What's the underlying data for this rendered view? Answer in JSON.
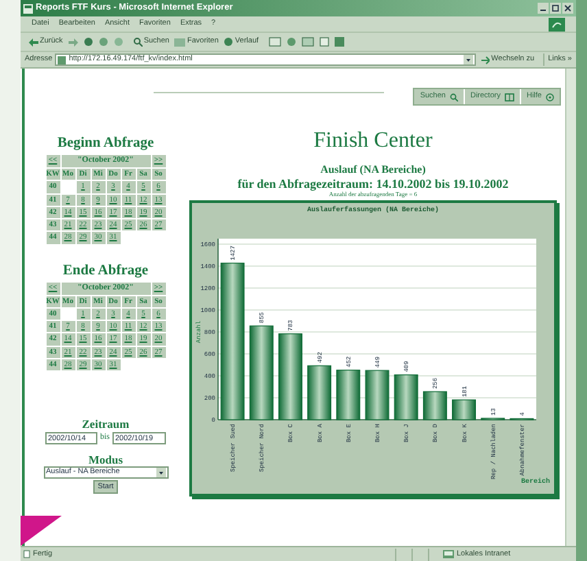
{
  "window": {
    "title": "Reports FTF Kurs - Microsoft Internet Explorer"
  },
  "menu": [
    "Datei",
    "Bearbeiten",
    "Ansicht",
    "Favoriten",
    "Extras",
    "?"
  ],
  "toolbar": {
    "back": "Zurück",
    "search": "Suchen",
    "favorites": "Favoriten",
    "history": "Verlauf"
  },
  "address_bar": {
    "label": "Adresse",
    "value": "http://172.16.49.174/ftf_kv/index.html",
    "go": "Wechseln zu",
    "links": "Links »"
  },
  "nav_buttons": [
    {
      "label": "Suchen",
      "kind": "search"
    },
    {
      "label": "Directory",
      "kind": "directory"
    },
    {
      "label": "Hilfe",
      "kind": "help"
    }
  ],
  "calendars": [
    {
      "heading": "Beginn Abfrage",
      "prev": "<<",
      "month": "\"October 2002\"",
      "next": ">>",
      "columns": [
        "KW",
        "Mo",
        "Di",
        "Mi",
        "Do",
        "Fr",
        "Sa",
        "So"
      ],
      "weeks": [
        {
          "week": "40",
          "leading_blank": true,
          "days": [
            "1",
            "2",
            "3",
            "4",
            "5",
            "6"
          ]
        },
        {
          "week": "41",
          "leading_blank": false,
          "days": [
            "7",
            "8",
            "9",
            "10",
            "11",
            "12",
            "13"
          ]
        },
        {
          "week": "42",
          "leading_blank": false,
          "days": [
            "14",
            "15",
            "16",
            "17",
            "18",
            "19",
            "20"
          ]
        },
        {
          "week": "43",
          "leading_blank": false,
          "days": [
            "21",
            "22",
            "23",
            "24",
            "25",
            "26",
            "27"
          ]
        },
        {
          "week": "44",
          "leading_blank": false,
          "days": [
            "28",
            "29",
            "30",
            "31"
          ]
        }
      ]
    },
    {
      "heading": "Ende Abfrage",
      "prev": "<<",
      "month": "\"October 2002\"",
      "next": ">>",
      "columns": [
        "KW",
        "Mo",
        "Di",
        "Mi",
        "Do",
        "Fr",
        "Sa",
        "So"
      ],
      "weeks": [
        {
          "week": "40",
          "leading_blank": true,
          "days": [
            "1",
            "2",
            "3",
            "4",
            "5",
            "6"
          ]
        },
        {
          "week": "41",
          "leading_blank": false,
          "days": [
            "7",
            "8",
            "9",
            "10",
            "11",
            "12",
            "13"
          ]
        },
        {
          "week": "42",
          "leading_blank": false,
          "days": [
            "14",
            "15",
            "16",
            "17",
            "18",
            "19",
            "20"
          ]
        },
        {
          "week": "43",
          "leading_blank": false,
          "days": [
            "21",
            "22",
            "23",
            "24",
            "25",
            "26",
            "27"
          ]
        },
        {
          "week": "44",
          "leading_blank": false,
          "days": [
            "28",
            "29",
            "30",
            "31"
          ]
        }
      ]
    }
  ],
  "period": {
    "label": "Zeitraum",
    "from": "2002/10/14",
    "separator": "bis",
    "to": "2002/10/19"
  },
  "mode": {
    "label": "Modus",
    "value": "Auslauf - NA Bereiche",
    "button": "Start"
  },
  "report": {
    "title": "Finish Center",
    "subtitle": "Auslauf (NA Bereiche)",
    "range": "für den Abfragezeitraum: 14.10.2002 bis 19.10.2002",
    "days": "Anzahl der abzufragenden Tage = 6",
    "chart_data": {
      "type": "bar",
      "title": "Auslauferfassungen (NA Bereiche)",
      "xlabel": "Bereich",
      "ylabel": "Anzahl",
      "categories": [
        "Speicher Sued",
        "Speicher Nord",
        "Box C",
        "Box A",
        "Box E",
        "Box H",
        "Box J",
        "Box D",
        "Box K",
        "Rep / Nachladen",
        "Abnahmefenster"
      ],
      "values": [
        1427,
        855,
        783,
        492,
        452,
        449,
        409,
        256,
        181,
        13,
        4
      ],
      "ylim": [
        0,
        1600
      ],
      "grid": true,
      "yticks": [
        0,
        200,
        400,
        600,
        800,
        1000,
        1200,
        1400,
        1600
      ],
      "data_labels": true
    }
  },
  "status_bar": {
    "text": "Fertig",
    "zone": "Lokales Intranet"
  }
}
